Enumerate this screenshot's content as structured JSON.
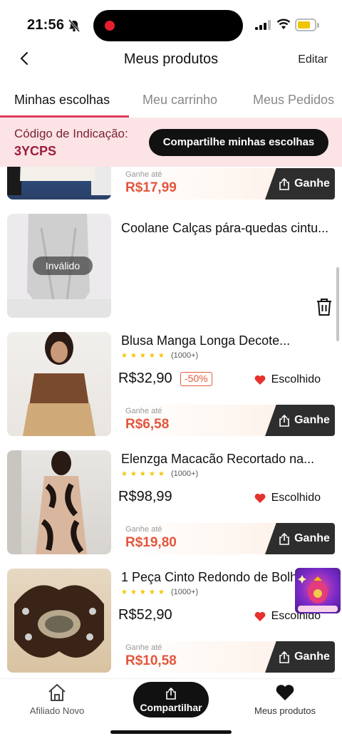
{
  "status_bar": {
    "time": "21:56"
  },
  "header": {
    "title": "Meus produtos",
    "edit_label": "Editar"
  },
  "tabs": [
    {
      "label": "Minhas escolhas",
      "active": true
    },
    {
      "label": "Meu carrinho",
      "active": false
    },
    {
      "label": "Meus Pedidos",
      "active": false
    }
  ],
  "referral": {
    "label": "Código de Indicação:",
    "code": "3YCPS",
    "share_button": "Compartilhe minhas escolhas"
  },
  "earn_label": "Ganhe até",
  "earn_button": "Ganhe",
  "chosen_label": "Escolhido",
  "invalid_label": "Inválido",
  "products": [
    {
      "earn": "R$17,99"
    },
    {
      "name": "Coolane Calças pára-quedas cintu...",
      "invalid": true
    },
    {
      "name": "Blusa Manga Longa Decote...",
      "reviews": "(1000+)",
      "price": "R$32,90",
      "discount": "-50%",
      "earn": "R$6,58"
    },
    {
      "name": "Elenzga Macacão Recortado na...",
      "reviews": "(1000+)",
      "price": "R$98,99",
      "earn": "R$19,80"
    },
    {
      "name": "1 Peça Cinto Redondo de Bolh...",
      "reviews": "(1000+)",
      "price": "R$52,90",
      "earn": "R$10,58"
    }
  ],
  "bottom_nav": {
    "affiliate": "Afiliado Novo",
    "share": "Compartilhar",
    "my_products": "Meus produtos"
  },
  "colors": {
    "accent": "#e23a5a",
    "earn": "#e2563d",
    "referral_bg": "#fbe3e6"
  }
}
